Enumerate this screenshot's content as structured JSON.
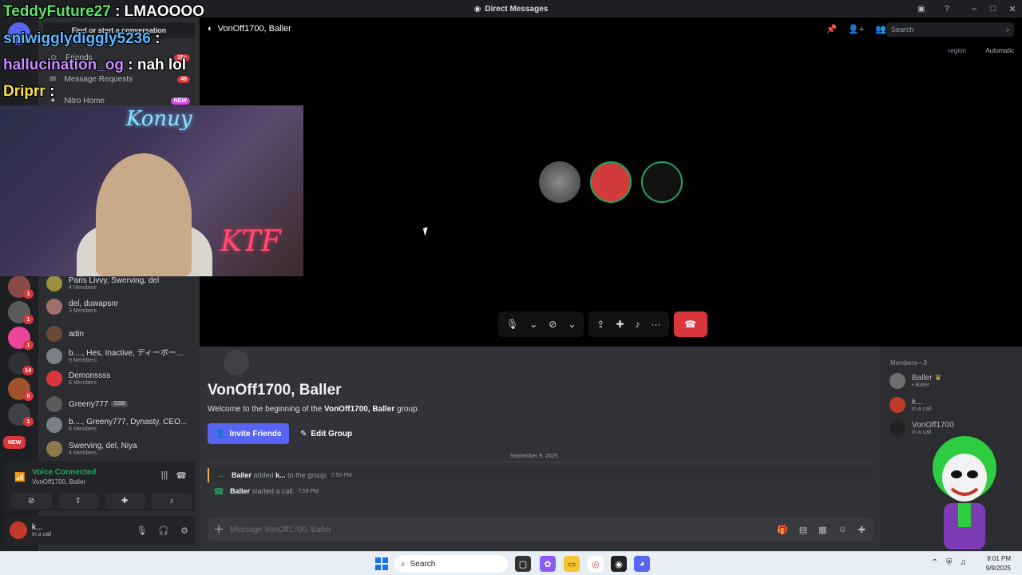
{
  "window": {
    "title": "Direct Messages",
    "icons": [
      "discord-logo-icon",
      "minimize-icon",
      "maximize-icon",
      "close-icon"
    ]
  },
  "stream_chat": [
    {
      "user": "TeddyFuture27",
      "message": ": LMAOOOO",
      "color": "#5ee36b"
    },
    {
      "user": "sniwigglydiggly5236",
      "message": ": ",
      "color": "#5fb8ff"
    },
    {
      "user": "hallucination_og",
      "message": ": nah lol",
      "color": "#c98bff"
    },
    {
      "user": "Driprr",
      "message": ": ",
      "color": "#ffe14d"
    }
  ],
  "webcam": {
    "sign": "Konuy",
    "neon": "KTF"
  },
  "sidebar": {
    "find_placeholder": "Find or start a conversation",
    "nav": [
      {
        "label": "Friends",
        "badge": "15+"
      },
      {
        "label": "Message Requests",
        "badge": "46"
      },
      {
        "label": "Nitro Home",
        "badge": "NEW"
      }
    ],
    "dms": [
      {
        "name": "Paris Livvy, Swerving, del",
        "sub": "4 Members",
        "color": "#9b8f3e"
      },
      {
        "name": "del, duwapsnr",
        "sub": "3 Members",
        "color": "#a0706b"
      },
      {
        "name": "adin",
        "sub": "",
        "color": "#6b4a3a"
      },
      {
        "name": "b...., Hes, Inactive, ディーポー...",
        "sub": "9 Members",
        "color": "#7a8088"
      },
      {
        "name": "Demonssss",
        "sub": "6 Members",
        "color": "#da373c"
      },
      {
        "name": "Greeny777",
        "sub": "",
        "tag": "SSB",
        "color": "#5a5a5a"
      },
      {
        "name": "b...., Greeny777, Dynasty, CEO...",
        "sub": "6 Members",
        "color": "#7a8088"
      },
      {
        "name": "Swerving, del, Niya",
        "sub": "4 Members",
        "color": "#8a7a4a"
      }
    ],
    "rail_badges": [
      "1",
      "1",
      "1",
      "14",
      "6",
      "1",
      "NEW"
    ]
  },
  "voice": {
    "status": "Voice Connected",
    "channel": "VonOff1700, Baller"
  },
  "user": {
    "name": "k...",
    "status": "In a call"
  },
  "stage": {
    "title": "VonOff1700, Baller",
    "search_placeholder": "Search",
    "region_label": "region",
    "region_value": "Automatic"
  },
  "chat": {
    "title": "VonOff1700, Baller",
    "welcome_prefix": "Welcome to the beginning of the",
    "welcome_name": "VonOff1700, Baller",
    "welcome_suffix": "group.",
    "invite_label": "Invite Friends",
    "edit_label": "Edit Group",
    "date_divider": "September 9, 2025",
    "messages": [
      {
        "actor": "Baller",
        "text1": "added",
        "target": "k...",
        "text2": "to the group.",
        "time": "7:59 PM"
      },
      {
        "actor": "Baller",
        "text1": "started a call.",
        "target": "",
        "text2": "",
        "time": "7:59 PM"
      }
    ],
    "composer_placeholder": "Message VonOff1700, Baller"
  },
  "members": {
    "header": "Members—3",
    "list": [
      {
        "name": "Baller",
        "sub": "• Baller",
        "color": "#6e6e6e"
      },
      {
        "name": "k...",
        "sub": "In a call",
        "color": "#c0392b"
      },
      {
        "name": "VonOff1700",
        "sub": "In a call",
        "color": "#222222"
      }
    ]
  },
  "taskbar": {
    "search_label": "Search",
    "time": "8:01 PM",
    "date": "9/9/2025"
  },
  "colors": {
    "blurple": "#5865f2",
    "danger": "#da373c",
    "online": "#23a55a"
  }
}
